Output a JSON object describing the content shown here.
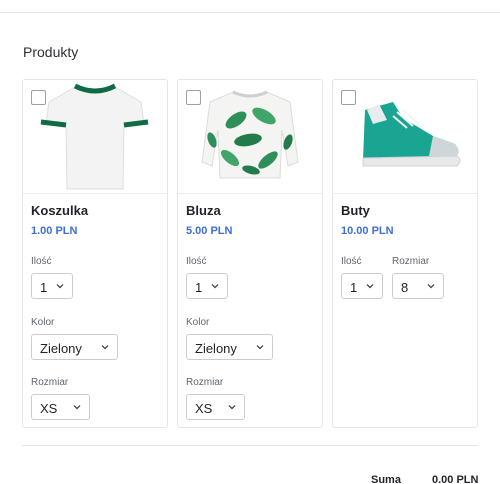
{
  "section": {
    "title": "Produkty"
  },
  "products": [
    {
      "name": "Koszulka",
      "price": "1.00 PLN",
      "quantity_label": "Ilość",
      "quantity_value": "1",
      "color_label": "Kolor",
      "color_value": "Zielony",
      "size_label": "Rozmiar",
      "size_value": "XS",
      "image": "white-tshirt-green-trim"
    },
    {
      "name": "Bluza",
      "price": "5.00 PLN",
      "quantity_label": "Ilość",
      "quantity_value": "1",
      "color_label": "Kolor",
      "color_value": "Zielony",
      "size_label": "Rozmiar",
      "size_value": "XS",
      "image": "leaf-print-sweatshirt"
    },
    {
      "name": "Buty",
      "price": "10.00 PLN",
      "quantity_label": "Ilość",
      "quantity_value": "1",
      "size_label": "Rozmiar",
      "size_value": "8",
      "image": "teal-high-top-sneaker"
    }
  ],
  "summary": {
    "label": "Suma",
    "value": "0.00 PLN"
  },
  "colors": {
    "price": "#3d6fd4",
    "border": "#e3e5e8",
    "tshirt_trim": "#0e6b46",
    "leaf": "#2f8f5b",
    "sneaker": "#1aa592"
  }
}
